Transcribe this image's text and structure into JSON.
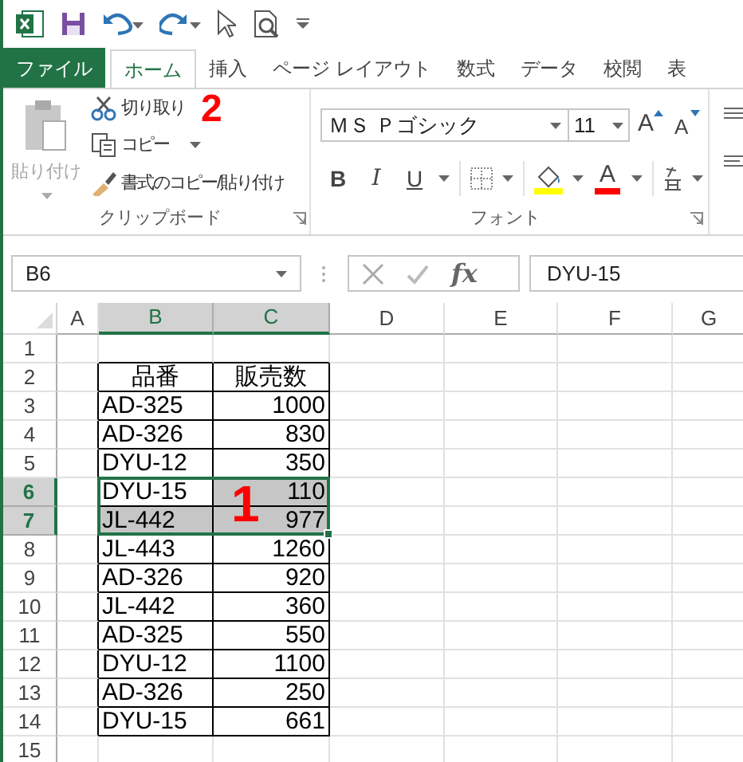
{
  "tabs": [
    {
      "label": "ファイル",
      "kind": "file",
      "selected": false
    },
    {
      "label": "ホーム",
      "kind": "tab",
      "selected": true
    },
    {
      "label": "挿入",
      "kind": "tab",
      "selected": false
    },
    {
      "label": "ページ レイアウト",
      "kind": "tab",
      "selected": false
    },
    {
      "label": "数式",
      "kind": "tab",
      "selected": false
    },
    {
      "label": "データ",
      "kind": "tab",
      "selected": false
    },
    {
      "label": "校閲",
      "kind": "tab",
      "selected": false
    },
    {
      "label": "表",
      "kind": "tab",
      "selected": false
    }
  ],
  "clipboard": {
    "paste": {
      "label": "貼り付け",
      "disabled": true
    },
    "cut": "切り取り",
    "copy": "コピー",
    "format_painter": "書式のコピー/貼り付け",
    "group_label": "クリップボード"
  },
  "font": {
    "name": "ＭＳ Ｐゴシック",
    "size": "11",
    "grow": "A",
    "shrink": "A",
    "bold": "B",
    "italic": "I",
    "underline": "U",
    "font_color": "A",
    "group_label": "フォント"
  },
  "annotations": [
    {
      "text": "2"
    },
    {
      "text": "1"
    }
  ],
  "name_box": "B6",
  "fx": "fx",
  "formula": "DYU-15",
  "columns": [
    {
      "label": "A",
      "selected": false
    },
    {
      "label": "B",
      "selected": true
    },
    {
      "label": "C",
      "selected": true
    },
    {
      "label": "D",
      "selected": false
    },
    {
      "label": "E",
      "selected": false
    },
    {
      "label": "F",
      "selected": false
    },
    {
      "label": "G",
      "selected": false
    }
  ],
  "rows": [
    {
      "number": "1",
      "selected": false
    },
    {
      "number": "2",
      "selected": false,
      "cells": [
        {
          "text": "品番",
          "kind": "header",
          "highlighted": false
        },
        {
          "text": "販売数",
          "kind": "header",
          "highlighted": false
        }
      ]
    },
    {
      "number": "3",
      "selected": false,
      "cells": [
        {
          "text": "AD-325",
          "kind": "text",
          "highlighted": false
        },
        {
          "text": "1000",
          "kind": "number",
          "highlighted": false
        }
      ]
    },
    {
      "number": "4",
      "selected": false,
      "cells": [
        {
          "text": "AD-326",
          "kind": "text",
          "highlighted": false
        },
        {
          "text": "830",
          "kind": "number",
          "highlighted": false
        }
      ]
    },
    {
      "number": "5",
      "selected": false,
      "cells": [
        {
          "text": "DYU-12",
          "kind": "text",
          "highlighted": false
        },
        {
          "text": "350",
          "kind": "number",
          "highlighted": false
        }
      ]
    },
    {
      "number": "6",
      "selected": true,
      "cells": [
        {
          "text": "DYU-15",
          "kind": "text",
          "highlighted": false
        },
        {
          "text": "110",
          "kind": "number",
          "highlighted": true
        }
      ]
    },
    {
      "number": "7",
      "selected": true,
      "cells": [
        {
          "text": "JL-442",
          "kind": "text",
          "highlighted": true
        },
        {
          "text": "977",
          "kind": "number",
          "highlighted": true
        }
      ]
    },
    {
      "number": "8",
      "selected": false,
      "cells": [
        {
          "text": "JL-443",
          "kind": "text",
          "highlighted": false
        },
        {
          "text": "1260",
          "kind": "number",
          "highlighted": false
        }
      ]
    },
    {
      "number": "9",
      "selected": false,
      "cells": [
        {
          "text": "AD-326",
          "kind": "text",
          "highlighted": false
        },
        {
          "text": "920",
          "kind": "number",
          "highlighted": false
        }
      ]
    },
    {
      "number": "10",
      "selected": false,
      "cells": [
        {
          "text": "JL-442",
          "kind": "text",
          "highlighted": false
        },
        {
          "text": "360",
          "kind": "number",
          "highlighted": false
        }
      ]
    },
    {
      "number": "11",
      "selected": false,
      "cells": [
        {
          "text": "AD-325",
          "kind": "text",
          "highlighted": false
        },
        {
          "text": "550",
          "kind": "number",
          "highlighted": false
        }
      ]
    },
    {
      "number": "12",
      "selected": false,
      "cells": [
        {
          "text": "DYU-12",
          "kind": "text",
          "highlighted": false
        },
        {
          "text": "1100",
          "kind": "number",
          "highlighted": false
        }
      ]
    },
    {
      "number": "13",
      "selected": false,
      "cells": [
        {
          "text": "AD-326",
          "kind": "text",
          "highlighted": false
        },
        {
          "text": "250",
          "kind": "number",
          "highlighted": false
        }
      ]
    },
    {
      "number": "14",
      "selected": false,
      "cells": [
        {
          "text": "DYU-15",
          "kind": "text",
          "highlighted": false
        },
        {
          "text": "661",
          "kind": "number",
          "highlighted": false
        }
      ]
    },
    {
      "number": "15",
      "selected": false
    }
  ]
}
